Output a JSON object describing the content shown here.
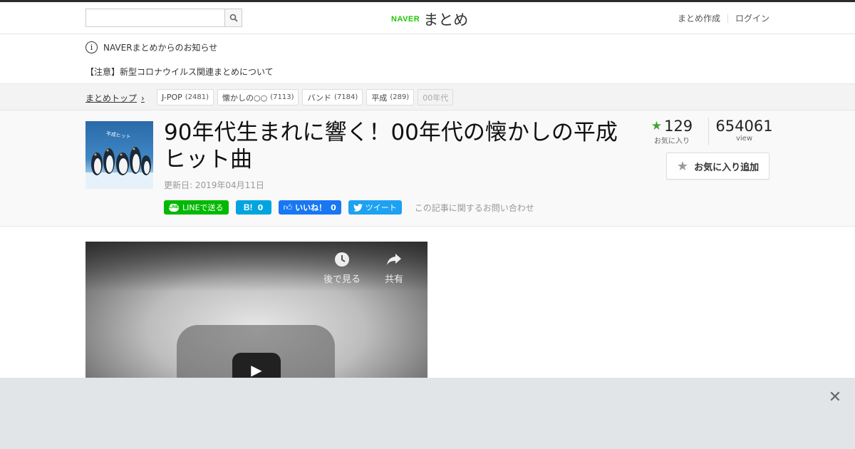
{
  "header": {
    "search_placeholder": "",
    "logo_naver": "NAVER",
    "logo_matome": "まとめ",
    "create_link": "まとめ作成",
    "login_link": "ログイン"
  },
  "notice": {
    "info_glyph": "i",
    "title": "NAVERまとめからのお知らせ",
    "item": "【注意】新型コロナウイルス関連まとめについて"
  },
  "breadcrumb": {
    "top_label": "まとめトップ",
    "tags": [
      {
        "label": "J-POP",
        "count": "(2481)"
      },
      {
        "label": "懐かしの○○",
        "count": "(7113)"
      },
      {
        "label": "バンド",
        "count": "(7184)"
      },
      {
        "label": "平成",
        "count": "(289)"
      },
      {
        "label": "00年代",
        "count": ""
      }
    ]
  },
  "article": {
    "title": "90年代生まれに響く！00年代の懐かしの平成ヒット曲",
    "updated": "更新日: 2019年04月11日",
    "thumb_caption": "平成ヒット",
    "share": {
      "line": "LINEで送る",
      "hatena_icon": "B!",
      "hatena_count": "0",
      "fb": "いいね！",
      "fb_count": "0",
      "tweet": "ツイート",
      "contact": "この記事に関するお問い合わせ"
    },
    "stats": {
      "fav_count": "129",
      "fav_label": "お気に入り",
      "view_count": "654061",
      "view_label": "view"
    },
    "fav_button": "お気に入り追加"
  },
  "video": {
    "watch_later": "後で見る",
    "share": "共有"
  },
  "colors": {
    "naver_green": "#1ec800",
    "line_green": "#00b900",
    "hatena_blue": "#00a4de",
    "fb_blue": "#1877f2",
    "twitter_blue": "#1da1f2",
    "star_green": "#3fa535"
  }
}
